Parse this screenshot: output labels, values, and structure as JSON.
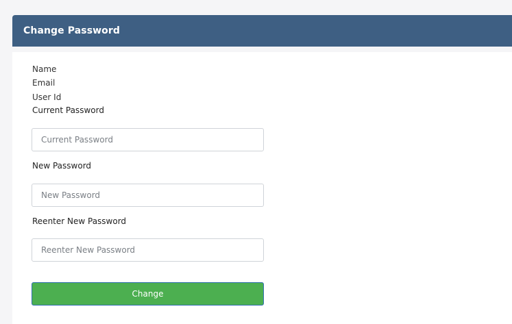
{
  "panel": {
    "title": "Change Password"
  },
  "user_info": {
    "name_label": "Name",
    "email_label": "Email",
    "user_id_label": "User Id"
  },
  "form": {
    "current_password": {
      "label": "Current Password",
      "placeholder": "Current Password",
      "value": ""
    },
    "new_password": {
      "label": "New Password",
      "placeholder": "New Password",
      "value": ""
    },
    "reenter_password": {
      "label": "Reenter New Password",
      "placeholder": "Reenter New Password",
      "value": ""
    },
    "submit_label": "Change"
  },
  "colors": {
    "header_bg": "#3e5f83",
    "button_bg": "#4caf50",
    "page_bg": "#f5f5f7"
  }
}
